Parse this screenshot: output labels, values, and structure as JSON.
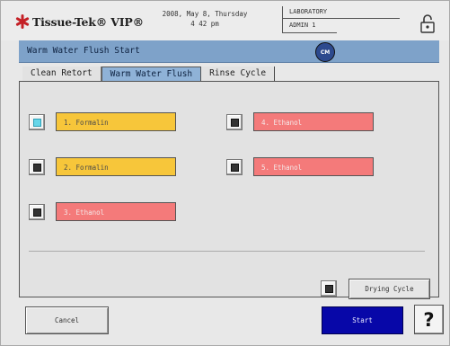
{
  "header": {
    "logo_text": "Tissue-Tek® VIP®",
    "date_line": "2008, May 8, Thursday",
    "time_line": "4 42 pm",
    "location": "LABORATORY",
    "user": "ADMIN 1"
  },
  "title_bar": {
    "title": "Warm Water Flush Start",
    "badge_text": "CM"
  },
  "tabs": [
    {
      "label": "Clean Retort",
      "active": false
    },
    {
      "label": "Warm Water Flush",
      "active": true
    },
    {
      "label": "Rinse Cycle",
      "active": false
    }
  ],
  "stations": [
    {
      "label": "1. Formalin",
      "color": "#f7c63a",
      "selected": true
    },
    {
      "label": "2. Formalin",
      "color": "#f7c63a",
      "selected": false
    },
    {
      "label": "3. Ethanol",
      "color": "#f47a7a",
      "selected": false
    },
    {
      "label": "4. Ethanol",
      "color": "#f47a7a",
      "selected": false
    },
    {
      "label": "5. Ethanol",
      "color": "#f47a7a",
      "selected": false
    }
  ],
  "drying_cycle": {
    "label": "Drying Cycle",
    "selected": false
  },
  "footer": {
    "cancel_label": "Cancel",
    "start_label": "Start",
    "help_label": "?"
  },
  "colors": {
    "title_bar": "#7ea2c9",
    "start_button": "#0707a8",
    "formalin": "#f7c63a",
    "ethanol": "#f47a7a",
    "selected_indicator": "#67d6e9"
  },
  "icons": {
    "logo": "asterisk-logo-icon",
    "lock": "lock-icon",
    "title_badge": "cm-badge-icon"
  }
}
